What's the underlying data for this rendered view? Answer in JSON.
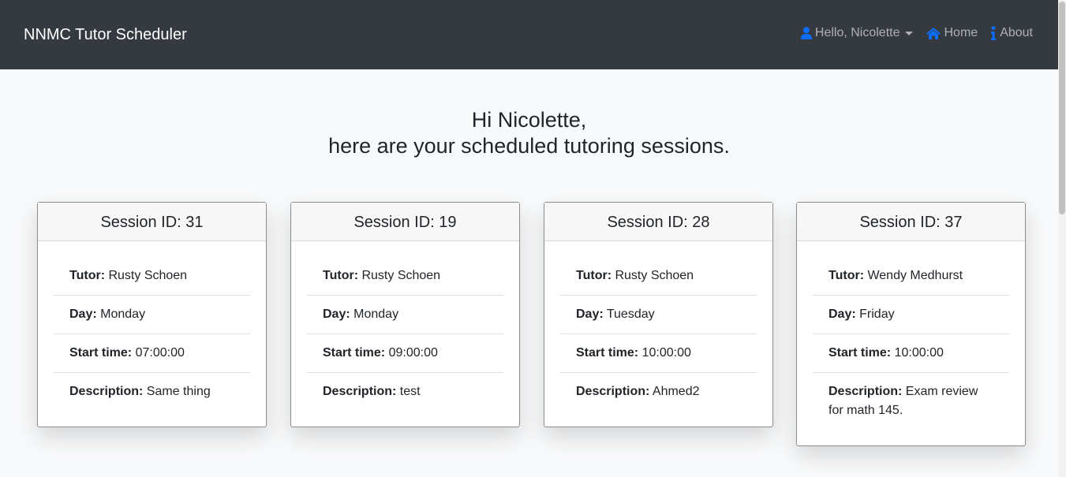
{
  "navbar": {
    "brand": "NNMC Tutor Scheduler",
    "user_menu": "Hello, Nicolette",
    "home": "Home",
    "about": "About",
    "icon_color": "#0d6efd"
  },
  "heading": {
    "line1": "Hi Nicolette,",
    "line2": "here are your scheduled tutoring sessions."
  },
  "labels": {
    "tutor": "Tutor:",
    "day": "Day:",
    "start": "Start time:",
    "description": "Description:"
  },
  "sessions": [
    {
      "header": "Session ID: 31",
      "tutor": "Rusty Schoen",
      "day": "Monday",
      "start": "07:00:00",
      "description": "Same thing"
    },
    {
      "header": "Session ID: 19",
      "tutor": "Rusty Schoen",
      "day": "Monday",
      "start": "09:00:00",
      "description": "test"
    },
    {
      "header": "Session ID: 28",
      "tutor": "Rusty Schoen",
      "day": "Tuesday",
      "start": "10:00:00",
      "description": "Ahmed2"
    },
    {
      "header": "Session ID: 37",
      "tutor": "Wendy Medhurst",
      "day": "Friday",
      "start": "10:00:00",
      "description": "Exam review for math 145."
    }
  ]
}
